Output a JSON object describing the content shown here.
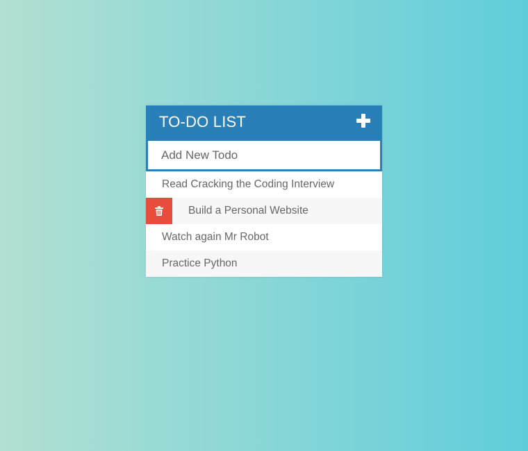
{
  "header": {
    "title": "TO-DO LIST",
    "add_icon": "plus-icon"
  },
  "input": {
    "placeholder": "Add New Todo",
    "value": ""
  },
  "todos": [
    {
      "text": "Read Cracking the Coding Interview",
      "hovered": false
    },
    {
      "text": "Build a Personal Website",
      "hovered": true
    },
    {
      "text": "Watch again Mr Robot",
      "hovered": false
    },
    {
      "text": "Practice Python",
      "hovered": false
    }
  ],
  "delete_icon": "trash-icon",
  "colors": {
    "header": "#2980b9",
    "delete": "#e74c3c",
    "gradient_start": "#b2e0d2",
    "gradient_end": "#60cddb"
  }
}
